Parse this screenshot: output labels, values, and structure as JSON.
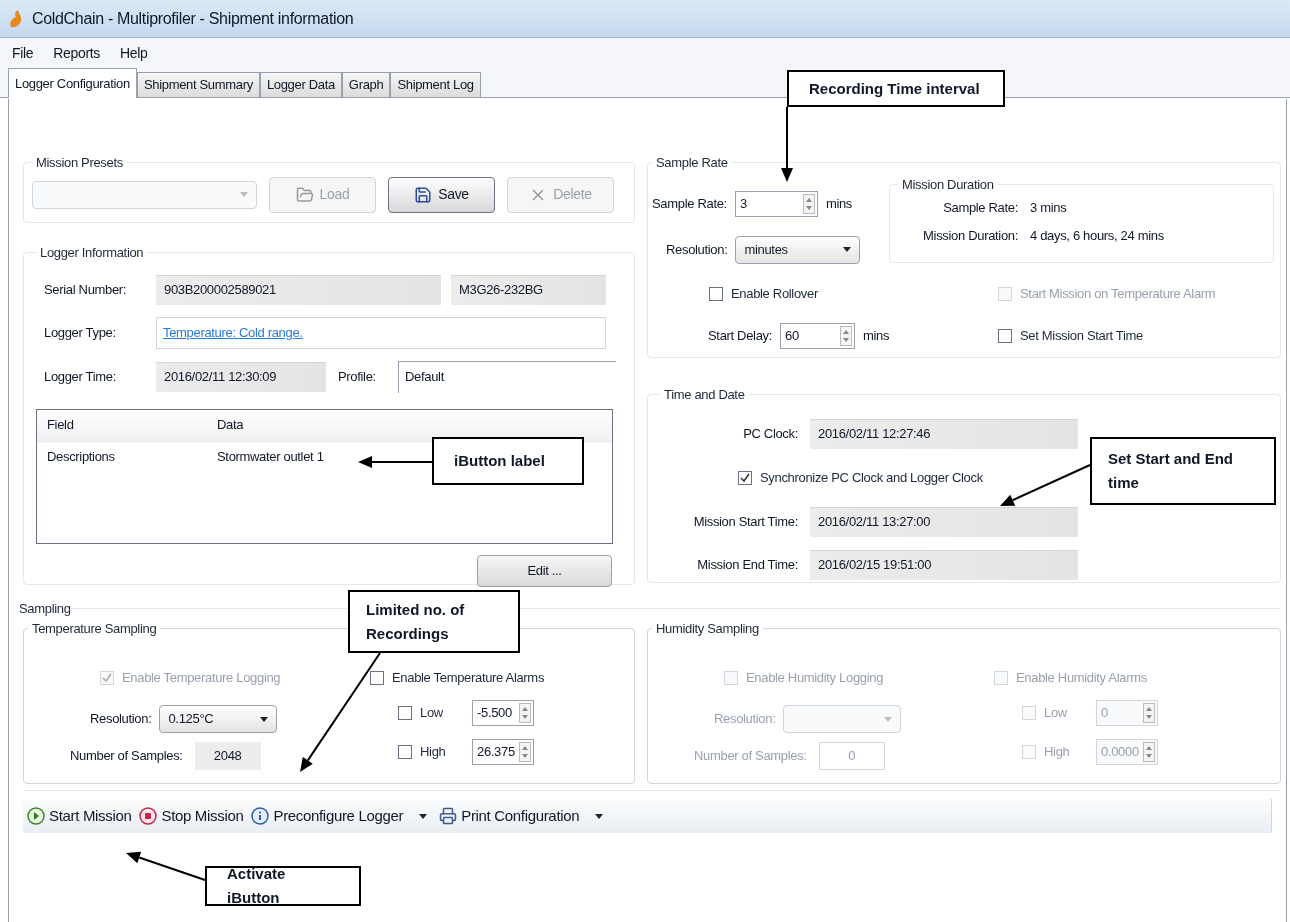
{
  "window": {
    "title": "ColdChain - Multiprofiler - Shipment information"
  },
  "menu": [
    {
      "label": "File"
    },
    {
      "label": "Reports"
    },
    {
      "label": "Help"
    }
  ],
  "tabs": [
    {
      "label": "Logger Configuration",
      "selected": true
    },
    {
      "label": "Shipment Summary",
      "selected": false
    },
    {
      "label": "Logger Data",
      "selected": false
    },
    {
      "label": "Graph",
      "selected": false
    },
    {
      "label": "Shipment Log",
      "selected": false
    }
  ],
  "mission_presets": {
    "title": "Mission Presets",
    "buttons": [
      {
        "label": "Load",
        "kind": "load",
        "disabled": true
      },
      {
        "label": "Save",
        "kind": "save",
        "disabled": false
      },
      {
        "label": "Delete",
        "kind": "delete",
        "disabled": true
      }
    ]
  },
  "logger_information": {
    "title": "Logger Information",
    "serial_label": "Serial Number:",
    "serial_number": "903B200002589021",
    "model": "M3G26-232BG",
    "type_label": "Logger Type:",
    "logger_type": "Temperature: Cold range.",
    "time_label": "Logger Time:",
    "logger_time": "2016/02/11 12:30:09",
    "profile_label": "Profile:",
    "profile": "Default",
    "table": {
      "columns": [
        "Field",
        "Data"
      ],
      "rows": [
        [
          "Descriptions",
          "Stormwater outlet 1"
        ]
      ]
    },
    "edit_button": "Edit ..."
  },
  "sample_rate": {
    "title": "Sample Rate",
    "rate_label": "Sample Rate:",
    "rate_value": "3",
    "rate_unit": "mins",
    "resolution_label": "Resolution:",
    "resolution": "minutes",
    "rollover": {
      "label": "Enable Rollover",
      "checked": false,
      "disabled": false
    },
    "temperature_alarm_start": {
      "label": "Start Mission on Temperature Alarm",
      "checked": false,
      "disabled": true
    },
    "delay_label": "Start Delay:",
    "delay_value": "60",
    "delay_unit": "mins",
    "set_start_time": {
      "label": "Set Mission Start Time",
      "checked": false,
      "disabled": false
    }
  },
  "mission_duration": {
    "title": "Mission Duration",
    "rows": [
      {
        "label": "Sample Rate:",
        "value": "3 mins"
      },
      {
        "label": "Mission Duration:",
        "value": "4 days, 6 hours, 24 mins"
      }
    ]
  },
  "time_and_date": {
    "title": "Time and Date",
    "pc_clock_label": "PC Clock:",
    "pc_clock": "2016/02/11 12:27:46",
    "sync": {
      "label": "Synchronize PC Clock and Logger Clock",
      "checked": true,
      "disabled": false
    },
    "start_label": "Mission Start Time:",
    "start": "2016/02/11 13:27:00",
    "end_label": "Mission End Time:",
    "end": "2016/02/15 19:51:00"
  },
  "sampling": {
    "title": "Sampling",
    "temperature": {
      "title": "Temperature Sampling",
      "disabled": false,
      "logging": {
        "label": "Enable Temperature Logging",
        "checked": true,
        "disabled": true
      },
      "alarms": {
        "label": "Enable Temperature Alarms",
        "checked": false,
        "disabled": false
      },
      "resolution_label": "Resolution:",
      "resolution": "0.125°C",
      "samples_label": "Number of Samples:",
      "samples": "2048",
      "low": {
        "label": "Low",
        "checked": false,
        "disabled": false,
        "value": "-5.500"
      },
      "high": {
        "label": "High",
        "checked": false,
        "disabled": false,
        "value": "26.375"
      }
    },
    "humidity": {
      "title": "Humidity Sampling",
      "disabled": true,
      "logging": {
        "label": "Enable Humidity Logging",
        "checked": false,
        "disabled": true
      },
      "alarms": {
        "label": "Enable Humidity Alarms",
        "checked": false,
        "disabled": true
      },
      "resolution_label": "Resolution:",
      "samples_label": "Number of Samples:",
      "samples": "0",
      "low": {
        "label": "Low",
        "checked": false,
        "disabled": true,
        "value": "0"
      },
      "high": {
        "label": "High",
        "checked": false,
        "disabled": true,
        "value": "0.0000"
      }
    }
  },
  "toolbar": [
    {
      "label": "Start Mission",
      "kind": "start",
      "dropdown": false
    },
    {
      "label": "Stop Mission",
      "kind": "stop",
      "dropdown": false
    },
    {
      "label": "Preconfigure Logger",
      "kind": "info",
      "dropdown": true
    },
    {
      "label": "Print Configuration",
      "kind": "print",
      "dropdown": true
    }
  ],
  "annotations": [
    {
      "text": "Recording Time interval"
    },
    {
      "text": "iButton label"
    },
    {
      "text": "Set Start and End time"
    },
    {
      "text": "Limited no. of Recordings"
    },
    {
      "text": "Activate iButton"
    }
  ]
}
